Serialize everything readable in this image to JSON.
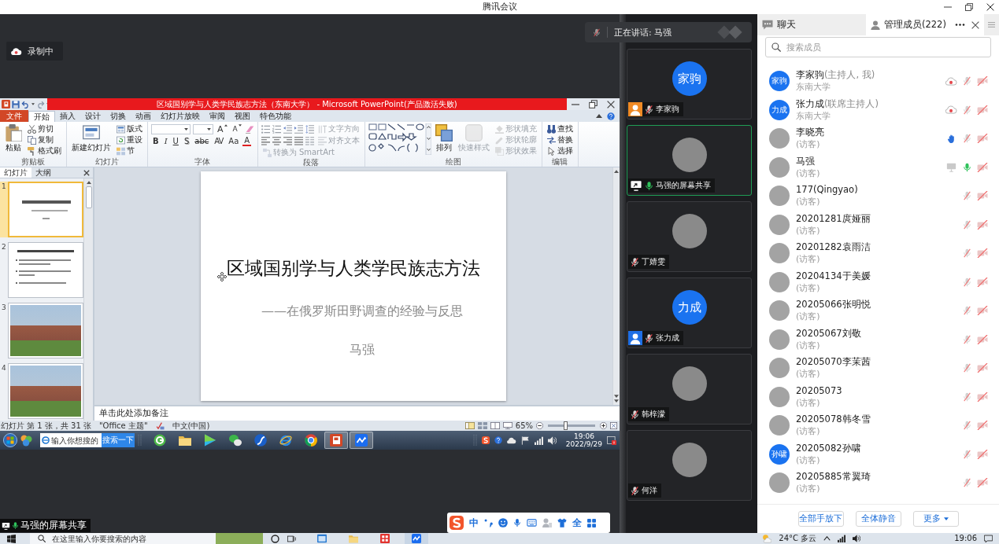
{
  "window": {
    "title": "腾讯会议"
  },
  "stage": {
    "recording": {
      "label": "录制中"
    },
    "speaker": {
      "label": "正在讲话: 马强",
      "mic_on": false
    },
    "share_tag": {
      "label": "马强的屏幕共享",
      "mic_on": true
    },
    "ime": {
      "mode": "中",
      "width": "全"
    }
  },
  "shared_screen": {
    "app_title": "区域国别学与人类学民族志方法（东南大学） - Microsoft PowerPoint(产品激活失败)",
    "ribbon_tabs": [
      {
        "label": "文件",
        "kind": "file",
        "selected": false
      },
      {
        "label": "开始",
        "kind": "tab",
        "selected": true
      },
      {
        "label": "插入",
        "kind": "tab",
        "selected": false
      },
      {
        "label": "设计",
        "kind": "tab",
        "selected": false
      },
      {
        "label": "切换",
        "kind": "tab",
        "selected": false
      },
      {
        "label": "动画",
        "kind": "tab",
        "selected": false
      },
      {
        "label": "幻灯片放映",
        "kind": "tab",
        "selected": false
      },
      {
        "label": "审阅",
        "kind": "tab",
        "selected": false
      },
      {
        "label": "视图",
        "kind": "tab",
        "selected": false
      },
      {
        "label": "特色功能",
        "kind": "tab",
        "selected": false
      }
    ],
    "ribbon_groups": [
      {
        "title": "剪贴板",
        "kind": "clipboard",
        "items": [
          {
            "label": "粘贴",
            "kind": "large",
            "disabled": false
          },
          {
            "label": "剪切",
            "kind": "small",
            "disabled": false
          },
          {
            "label": "复制",
            "kind": "small",
            "disabled": false
          },
          {
            "label": "格式刷",
            "kind": "small",
            "disabled": false
          }
        ]
      },
      {
        "title": "幻灯片",
        "kind": "slides",
        "items": [
          {
            "label": "新建幻灯片",
            "kind": "large",
            "disabled": false
          },
          {
            "label": "版式",
            "kind": "small",
            "disabled": false
          },
          {
            "label": "重设",
            "kind": "small",
            "disabled": false
          },
          {
            "label": "节",
            "kind": "small",
            "disabled": false
          }
        ]
      },
      {
        "title": "字体",
        "kind": "font",
        "items": [
          {
            "kind": "field",
            "disabled": false
          },
          {
            "kind": "field",
            "disabled": false
          },
          {
            "label": "A",
            "kind": "grow",
            "disabled": false
          },
          {
            "label": "A",
            "kind": "shrink",
            "disabled": false
          },
          {
            "label": "B",
            "kind": "bold",
            "disabled": false
          },
          {
            "label": "I",
            "kind": "italic",
            "disabled": false
          },
          {
            "label": "U",
            "kind": "underline",
            "disabled": false
          },
          {
            "label": "S",
            "kind": "shadow",
            "disabled": false
          },
          {
            "label": "abc",
            "kind": "strike",
            "disabled": false
          },
          {
            "label": "AV",
            "kind": "spacing",
            "disabled": false
          },
          {
            "label": "Aa",
            "kind": "case",
            "disabled": false
          },
          {
            "label": "A",
            "kind": "color",
            "disabled": false
          }
        ]
      },
      {
        "title": "段落",
        "kind": "paragraph",
        "items": [
          {
            "label": "文字方向",
            "kind": "small",
            "disabled": true
          },
          {
            "label": "对齐文本",
            "kind": "small",
            "disabled": true
          },
          {
            "label": "转换为 SmartArt",
            "kind": "small",
            "disabled": true
          }
        ]
      },
      {
        "title": "绘图",
        "kind": "drawing",
        "items": [
          {
            "label": "排列",
            "kind": "large",
            "disabled": false
          },
          {
            "label": "快速样式",
            "kind": "large",
            "disabled": true
          },
          {
            "label": "形状填充",
            "kind": "small",
            "disabled": true
          },
          {
            "label": "形状轮廓",
            "kind": "small",
            "disabled": true
          },
          {
            "label": "形状效果",
            "kind": "small",
            "disabled": true
          }
        ]
      },
      {
        "title": "编辑",
        "kind": "editing",
        "items": [
          {
            "label": "查找",
            "kind": "small",
            "disabled": false
          },
          {
            "label": "替换",
            "kind": "small",
            "disabled": false
          },
          {
            "label": "选择",
            "kind": "small",
            "disabled": false
          }
        ]
      }
    ],
    "pane_tabs": [
      {
        "label": "幻灯片",
        "selected": true
      },
      {
        "label": "大纲",
        "selected": false
      }
    ],
    "thumbnails": [
      {
        "number": "1",
        "kind": "title",
        "selected": true
      },
      {
        "number": "2",
        "kind": "bullets",
        "selected": false
      },
      {
        "number": "3",
        "kind": "photo",
        "selected": false
      },
      {
        "number": "4",
        "kind": "photo",
        "selected": false
      }
    ],
    "slide": {
      "title": "区域国别学与人类学民族志方法",
      "subtitle": "——在俄罗斯田野调查的经验与反思",
      "author": "马强"
    },
    "notes": {
      "placeholder": "单击此处添加备注"
    },
    "status_bar": {
      "slide_info": "幻灯片 第 1 张，共 31 张",
      "theme": "\"Office 主题\"",
      "language": "中文(中国)",
      "zoom": "65%",
      "zoom_slider": {
        "level": 0.36
      }
    },
    "taskbar": {
      "search_placeholder": "输入你想搜的",
      "search_button": "搜索一下",
      "apps": [
        {
          "active": false
        },
        {
          "active": false
        },
        {
          "active": false
        },
        {
          "active": false
        },
        {
          "active": false
        },
        {
          "active": false
        },
        {
          "active": false
        },
        {
          "active": true
        },
        {
          "active": true
        }
      ],
      "time": "19:06",
      "date": "2022/9/29"
    }
  },
  "video_tiles": [
    {
      "name": "李家驹",
      "avatar": {
        "kind": "text",
        "label": "家驹"
      },
      "badge": {
        "kind": "host"
      },
      "mic_on": false,
      "selected": false
    },
    {
      "name": "马强的屏幕共享",
      "avatar": {
        "kind": "photo"
      },
      "badge": {
        "kind": "screen"
      },
      "mic_on": true,
      "selected": true
    },
    {
      "name": "丁婧雯",
      "avatar": {
        "kind": "photo"
      },
      "mic_on": false,
      "selected": false
    },
    {
      "name": "张力成",
      "avatar": {
        "kind": "text",
        "label": "力成"
      },
      "badge": {
        "kind": "cohost"
      },
      "mic_on": false,
      "selected": false
    },
    {
      "name": "韩梓濛",
      "avatar": {
        "kind": "photo"
      },
      "mic_on": false,
      "selected": false
    },
    {
      "name": "何洋",
      "avatar": {
        "kind": "photo"
      },
      "mic_on": false,
      "selected": false
    }
  ],
  "members_panel": {
    "tabs": [
      {
        "label": "聊天",
        "kind": "chat",
        "selected": false
      },
      {
        "label": "管理成员(222)",
        "kind": "members",
        "selected": true
      }
    ],
    "search": {
      "placeholder": "搜索成员"
    },
    "members": [
      {
        "name": "李家驹",
        "role": "(主持人, 我)",
        "subtitle": "东南大学",
        "avatar": {
          "kind": "text",
          "label": "家驹"
        },
        "status": {
          "kind": "recording"
        },
        "mic_on": false,
        "camera_on": false
      },
      {
        "name": "张力成",
        "role": "(联席主持人)",
        "subtitle": "东南大学",
        "avatar": {
          "kind": "text",
          "label": "力成"
        },
        "status": {
          "kind": "recording"
        },
        "mic_on": false,
        "camera_on": false
      },
      {
        "name": "李晓亮",
        "subtitle": "(访客)",
        "avatar": {
          "kind": "photo"
        },
        "status": {
          "kind": "hand_raised"
        },
        "mic_on": false,
        "camera_on": false
      },
      {
        "name": "马强",
        "subtitle": "(访客)",
        "avatar": {
          "kind": "photo"
        },
        "status": {
          "kind": "sharing"
        },
        "mic_on": true,
        "camera_on": false
      },
      {
        "name": "177(Qingyao)",
        "subtitle": "(访客)",
        "avatar": {
          "kind": "photo"
        },
        "mic_on": false,
        "camera_on": false
      },
      {
        "name": "20201281庹娅丽",
        "subtitle": "(访客)",
        "avatar": {
          "kind": "photo"
        },
        "mic_on": false,
        "camera_on": false
      },
      {
        "name": "20201282袁雨洁",
        "subtitle": "(访客)",
        "avatar": {
          "kind": "photo"
        },
        "mic_on": false,
        "camera_on": false
      },
      {
        "name": "20204134于美媛",
        "subtitle": "(访客)",
        "avatar": {
          "kind": "photo"
        },
        "mic_on": false,
        "camera_on": false
      },
      {
        "name": "20205066张明悦",
        "subtitle": "(访客)",
        "avatar": {
          "kind": "photo"
        },
        "mic_on": false,
        "camera_on": false
      },
      {
        "name": "20205067刘敬",
        "subtitle": "(访客)",
        "avatar": {
          "kind": "photo"
        },
        "mic_on": false,
        "camera_on": false
      },
      {
        "name": "20205070李茉茜",
        "subtitle": "(访客)",
        "avatar": {
          "kind": "photo"
        },
        "mic_on": false,
        "camera_on": false
      },
      {
        "name": "20205073",
        "subtitle": "(访客)",
        "avatar": {
          "kind": "photo"
        },
        "mic_on": false,
        "camera_on": false
      },
      {
        "name": "20205078韩冬雪",
        "subtitle": "(访客)",
        "avatar": {
          "kind": "photo"
        },
        "mic_on": false,
        "camera_on": false
      },
      {
        "name": "20205082孙啸",
        "subtitle": "(访客)",
        "avatar": {
          "kind": "text",
          "label": "孙啸"
        },
        "mic_on": false,
        "camera_on": false
      },
      {
        "name": "20205885常翼琦",
        "subtitle": "(访客)",
        "avatar": {
          "kind": "photo"
        },
        "mic_on": false,
        "camera_on": false
      }
    ],
    "buttons": [
      {
        "label": "全部手放下",
        "dropdown": false
      },
      {
        "label": "全体静音",
        "dropdown": false
      },
      {
        "label": "更多",
        "dropdown": true
      }
    ]
  },
  "host_taskbar": {
    "search_placeholder": "在这里输入你要搜索的内容",
    "apps": [
      {
        "active": false
      },
      {
        "active": false
      },
      {
        "active": false
      },
      {
        "active": true
      }
    ],
    "weather": "24°C 多云",
    "time": "19:06"
  }
}
